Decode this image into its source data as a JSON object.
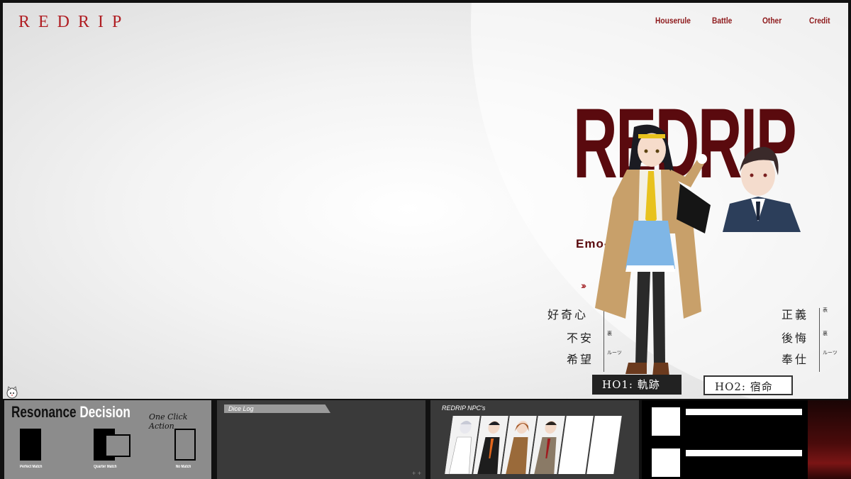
{
  "header": {
    "logo": "REDRIP",
    "nav": [
      "Houserule",
      "Battle",
      "Other",
      "Credit"
    ]
  },
  "hero": {
    "title": "REDRIP",
    "subtitle": "Emo-H        PG",
    "chevrons": "›››"
  },
  "traits_left": [
    {
      "label": "好奇心",
      "tag": "表"
    },
    {
      "label": "不安",
      "tag": "裏"
    },
    {
      "label": "希望",
      "tag": "ルーツ"
    }
  ],
  "traits_right": [
    {
      "label": "正義",
      "tag": "表"
    },
    {
      "label": "後悔",
      "tag": "裏"
    },
    {
      "label": "奉仕",
      "tag": "ルーツ"
    }
  ],
  "handouts": {
    "ho1": "HO1: 軌跡",
    "ho2": "HO2: 宿命"
  },
  "panels": {
    "resonance": {
      "title_a": "Resonance",
      "title_b": "Decision",
      "action": "One Click Action",
      "options": [
        "Perfect Match",
        "Quarter Match",
        "No Match"
      ]
    },
    "dice_log": {
      "title": "Dice Log",
      "plus": "+ +"
    },
    "npcs": {
      "title": "REDRIP NPC's"
    }
  },
  "colors": {
    "brand_red": "#b01e23",
    "deep_red": "#5a0a0e",
    "panel_dark": "#3a3a3a",
    "panel_grey": "#8c8c8c"
  }
}
